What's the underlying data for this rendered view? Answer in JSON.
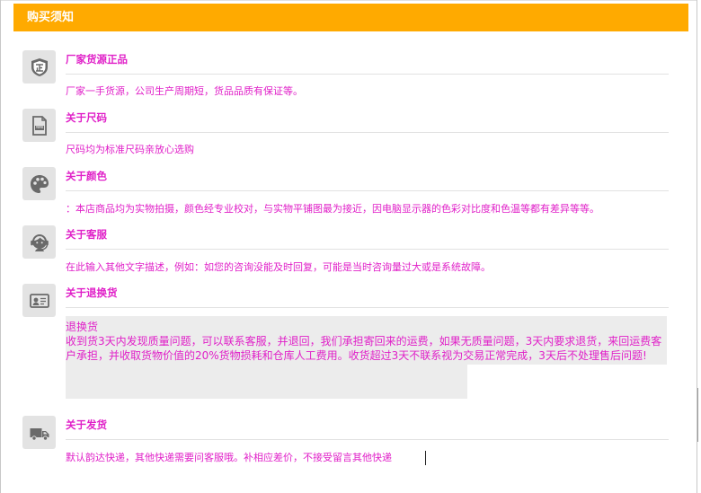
{
  "header": {
    "title": "购买须知"
  },
  "sections": [
    {
      "icon": "badge-zheng-icon",
      "title": "厂家货源正品",
      "desc": "厂家一手货源，公司生产周期短，货品品质有保证等。"
    },
    {
      "icon": "ruler-document-icon",
      "title": "关于尺码",
      "desc": "尺码均为标准尺码亲放心选购"
    },
    {
      "icon": "palette-icon",
      "title": "关于颜色",
      "desc": "：本店商品均为实物拍摄，颜色经专业校对，与实物平铺图最为接近，因电脑显示器的色彩对比度和色温等都有差异等等。"
    },
    {
      "icon": "customer-service-icon",
      "title": "关于客服",
      "desc": "在此输入其他文字描述，例如：如您的咨询没能及时回复，可能是当时咨询量过大或是系统故障。"
    },
    {
      "icon": "id-card-icon",
      "title": "关于退换货",
      "body_lines": [
        "退换货",
        "收到货3天内发现质量问题，可以联系客服，并退回，我们承担寄回来的运费，如果无质量问题，3天内要求退货，来回运费客",
        "户承担，并收取货物价值的20%货物损耗和仓库人工费用。收货超过3天不联系视为交易正常完成，3天后不处理售后问题!"
      ]
    },
    {
      "icon": "truck-icon",
      "title": "关于发货",
      "desc": "默认韵达快递，其他快递需要问客服哦。补相应差价，不接受留言其他快递"
    }
  ],
  "colors": {
    "header_bg": "#ffaa00",
    "accent_text": "#e020c8",
    "icon_bg": "#e3e3e3"
  }
}
